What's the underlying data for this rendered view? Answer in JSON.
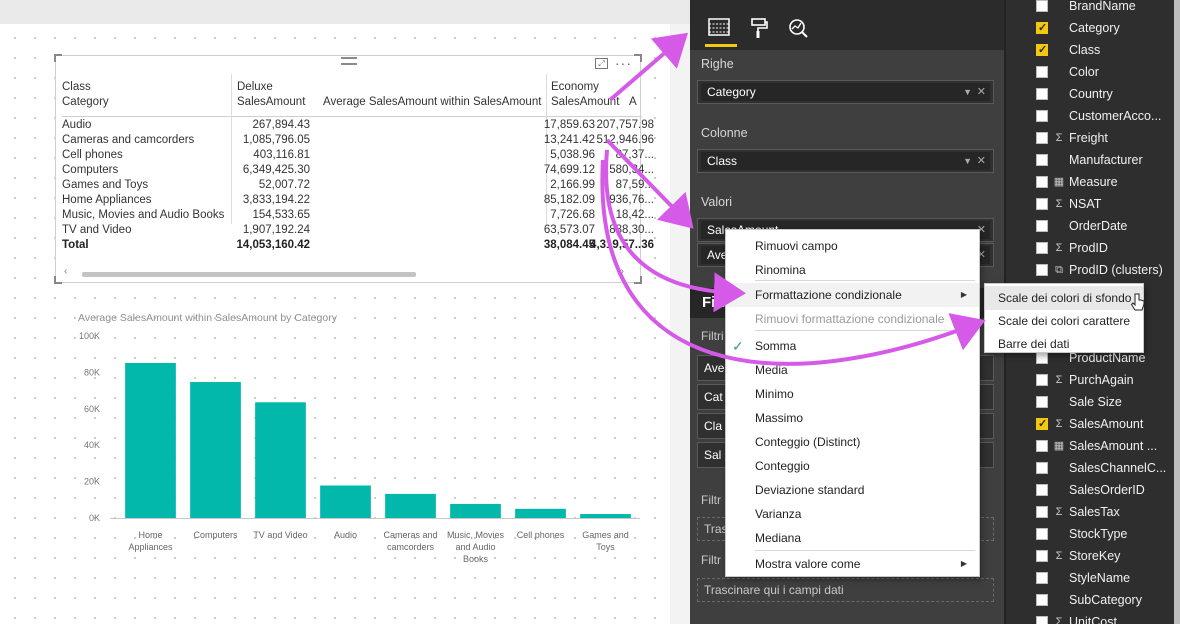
{
  "matrix": {
    "headers": {
      "row_header_1": "Class",
      "row_header_2": "Category",
      "deluxe_1": "Deluxe",
      "deluxe_2": "SalesAmount",
      "avg": "Average SalesAmount within SalesAmount",
      "economy_1": "Economy",
      "economy_2": "SalesAmount",
      "next_col": "A"
    },
    "rows": [
      {
        "category": "Audio",
        "deluxe": "267,894.43",
        "avg": "17,859.63",
        "economy": "207,757.98"
      },
      {
        "category": "Cameras and camcorders",
        "deluxe": "1,085,796.05",
        "avg": "13,241.42",
        "economy": "512,946.96"
      },
      {
        "category": "Cell phones",
        "deluxe": "403,116.81",
        "avg": "5,038.96",
        "economy": "87,37..."
      },
      {
        "category": "Computers",
        "deluxe": "6,349,425.30",
        "avg": "74,699.12",
        "economy": "1,580,34..."
      },
      {
        "category": "Games and Toys",
        "deluxe": "52,007.72",
        "avg": "2,166.99",
        "economy": "87,59..."
      },
      {
        "category": "Home Appliances",
        "deluxe": "3,833,194.22",
        "avg": "85,182.09",
        "economy": "936,76..."
      },
      {
        "category": "Music, Movies and Audio Books",
        "deluxe": "154,533.65",
        "avg": "7,726.68",
        "economy": "18,42..."
      },
      {
        "category": "TV and Video",
        "deluxe": "1,907,192.24",
        "avg": "63,573.07",
        "economy": "888,30..."
      }
    ],
    "total": {
      "label": "Total",
      "deluxe": "14,053,160.42",
      "avg": "38,084.45",
      "economy": "4,319,57..36"
    }
  },
  "chart_data": {
    "type": "bar",
    "title": "Average SalesAmount within SalesAmount by Category",
    "categories": [
      "Home Appliances",
      "Computers",
      "TV and Video",
      "Audio",
      "Cameras and camcorders",
      "Music, Movies and Audio Books",
      "Cell phones",
      "Games and Toys"
    ],
    "values": [
      85182.09,
      74699.12,
      63573.07,
      17859.63,
      13241.42,
      7726.68,
      5038.96,
      2166.99
    ],
    "yticks": [
      "0K",
      "20K",
      "40K",
      "60K",
      "80K",
      "100K"
    ],
    "ylim": [
      0,
      100000
    ],
    "bar_color": "#01b8aa",
    "grid": false
  },
  "pane": {
    "rows_label": "Righe",
    "rows_field": "Category",
    "columns_label": "Colonne",
    "columns_field": "Class",
    "values_label": "Valori",
    "values_field_1": "SalesAmount",
    "values_field_2": "Ave",
    "filters_title": "Filt",
    "filters_sub_1": "Filtri",
    "filter_items": [
      "Ave",
      "Cat",
      "Cla",
      "Sal"
    ],
    "filters_sub_2": "Filtr",
    "drop_1": "Trasc",
    "filters_sub_3": "Filtr",
    "drop_2": "Trascinare qui i campi dati"
  },
  "fields": [
    {
      "name": "BrandName",
      "checked": false,
      "type": ""
    },
    {
      "name": "Category",
      "checked": true,
      "type": ""
    },
    {
      "name": "Class",
      "checked": true,
      "type": ""
    },
    {
      "name": "Color",
      "checked": false,
      "type": ""
    },
    {
      "name": "Country",
      "checked": false,
      "type": ""
    },
    {
      "name": "CustomerAcco...",
      "checked": false,
      "type": ""
    },
    {
      "name": "Freight",
      "checked": false,
      "type": "Σ"
    },
    {
      "name": "Manufacturer",
      "checked": false,
      "type": ""
    },
    {
      "name": "Measure",
      "checked": false,
      "type": "▦"
    },
    {
      "name": "NSAT",
      "checked": false,
      "type": "Σ"
    },
    {
      "name": "OrderDate",
      "checked": false,
      "type": ""
    },
    {
      "name": "ProdID",
      "checked": false,
      "type": "Σ"
    },
    {
      "name": "ProdID (clusters)",
      "checked": false,
      "type": "⧉"
    },
    {
      "name": "...",
      "checked": false,
      "type": ""
    },
    {
      "name": "...",
      "checked": false,
      "type": ""
    },
    {
      "name": "...",
      "checked": false,
      "type": ""
    },
    {
      "name": "ProductName",
      "checked": false,
      "type": ""
    },
    {
      "name": "PurchAgain",
      "checked": false,
      "type": "Σ"
    },
    {
      "name": "Sale Size",
      "checked": false,
      "type": ""
    },
    {
      "name": "SalesAmount",
      "checked": true,
      "type": "Σ"
    },
    {
      "name": "SalesAmount ...",
      "checked": false,
      "type": "▦"
    },
    {
      "name": "SalesChannelC...",
      "checked": false,
      "type": ""
    },
    {
      "name": "SalesOrderID",
      "checked": false,
      "type": ""
    },
    {
      "name": "SalesTax",
      "checked": false,
      "type": "Σ"
    },
    {
      "name": "StockType",
      "checked": false,
      "type": ""
    },
    {
      "name": "StoreKey",
      "checked": false,
      "type": "Σ"
    },
    {
      "name": "StyleName",
      "checked": false,
      "type": ""
    },
    {
      "name": "SubCategory",
      "checked": false,
      "type": ""
    },
    {
      "name": "UnitCost",
      "checked": false,
      "type": "Σ"
    }
  ],
  "context_menu": {
    "items": [
      "Rimuovi campo",
      "Rinomina",
      "Formattazione condizionale",
      "Rimuovi formattazione condizionale",
      "Somma",
      "Media",
      "Minimo",
      "Massimo",
      "Conteggio (Distinct)",
      "Conteggio",
      "Deviazione standard",
      "Varianza",
      "Mediana",
      "Mostra valore come"
    ],
    "checked_item": "Somma",
    "disabled_item": "Rimuovi formattazione condizionale"
  },
  "submenu": {
    "items": [
      "Scale dei colori di sfondo",
      "Scale dei colori carattere",
      "Barre dei dati"
    ]
  },
  "colors": {
    "accent_yellow": "#f2c811",
    "arrow_magenta": "#d55ae8",
    "bar_teal": "#01b8aa"
  },
  "icons": [
    "table-icon",
    "paint-roller-icon",
    "analytics-icon",
    "focus-mode-icon",
    "more-options-icon",
    "dropdown-icon",
    "close-icon",
    "checkmark-icon",
    "submenu-arrow-icon",
    "pointer-cursor-icon"
  ]
}
